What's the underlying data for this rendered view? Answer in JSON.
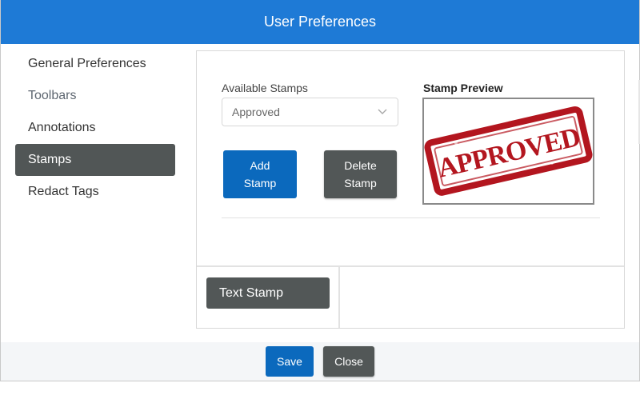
{
  "dialog": {
    "title": "User Preferences"
  },
  "sidebar": {
    "items": [
      {
        "label": "General Preferences",
        "state": "normal"
      },
      {
        "label": "Toolbars",
        "state": "muted"
      },
      {
        "label": "Annotations",
        "state": "normal"
      },
      {
        "label": "Stamps",
        "state": "active"
      },
      {
        "label": "Redact Tags",
        "state": "normal"
      }
    ]
  },
  "stamps": {
    "available_label": "Available Stamps",
    "selected_stamp": "Approved",
    "add_label_line1": "Add",
    "add_label_line2": "Stamp",
    "delete_label_line1": "Delete",
    "delete_label_line2": "Stamp",
    "preview_label": "Stamp Preview",
    "preview_stamp_text": "APPROVED",
    "text_stamp_label": "Text Stamp"
  },
  "footer": {
    "save_label": "Save",
    "close_label": "Close"
  },
  "colors": {
    "titlebar": "#1e7ad6",
    "primary": "#0b69bd",
    "dark": "#525757",
    "stamp_red": "#b3161f"
  },
  "icons": {
    "select_chevron": "chevron-down-icon"
  }
}
